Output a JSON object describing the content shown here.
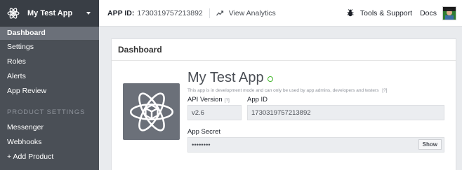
{
  "sidebar": {
    "app_name": "My Test App",
    "items": [
      {
        "label": "Dashboard"
      },
      {
        "label": "Settings"
      },
      {
        "label": "Roles"
      },
      {
        "label": "Alerts"
      },
      {
        "label": "App Review"
      }
    ],
    "section_label": "PRODUCT SETTINGS",
    "products": [
      {
        "label": "Messenger"
      },
      {
        "label": "Webhooks"
      },
      {
        "label": "+ Add Product"
      }
    ]
  },
  "topbar": {
    "app_id_label": "APP ID:",
    "app_id_value": "1730319757213892",
    "analytics_label": "View Analytics",
    "tools_label": "Tools & Support",
    "docs_label": "Docs"
  },
  "panel": {
    "header": "Dashboard",
    "app_title": "My Test App",
    "dev_note": "This app is in development mode and can only be used by app admins, developers and testers",
    "dev_note_help": "[?]",
    "api_version_label": "API Version",
    "api_version_help": "[?]",
    "api_version_value": "v2.6",
    "app_id_label": "App ID",
    "app_id_value": "1730319757213892",
    "app_secret_label": "App Secret",
    "app_secret_value": "••••••••",
    "show_label": "Show"
  },
  "colors": {
    "sidebar_bg": "#4a4f56",
    "sidebar_header_bg": "#393e45",
    "active_item_bg": "#6b7079",
    "status_green": "#42b72a"
  },
  "icons": {
    "app_icon": "atom-cube-icon",
    "analytics_icon": "trend-line-icon",
    "tools_icon": "bug-icon",
    "avatar": "user-avatar"
  }
}
